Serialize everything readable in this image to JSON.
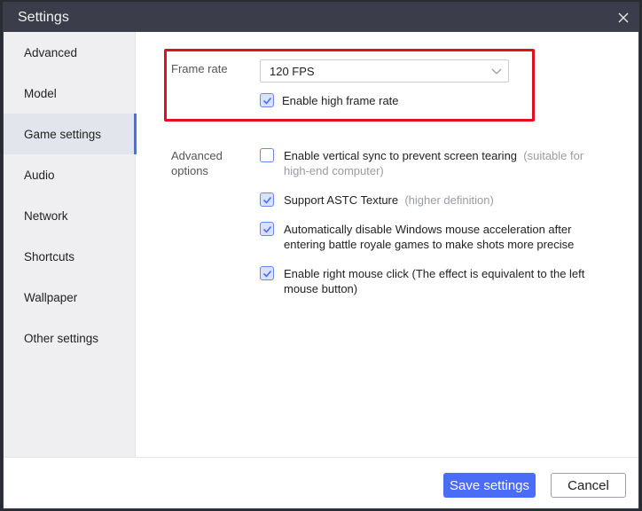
{
  "window": {
    "title": "Settings"
  },
  "sidebar": {
    "items": [
      {
        "label": "Advanced",
        "active": false
      },
      {
        "label": "Model",
        "active": false
      },
      {
        "label": "Game settings",
        "active": true
      },
      {
        "label": "Audio",
        "active": false
      },
      {
        "label": "Network",
        "active": false
      },
      {
        "label": "Shortcuts",
        "active": false
      },
      {
        "label": "Wallpaper",
        "active": false
      },
      {
        "label": "Other settings",
        "active": false
      }
    ]
  },
  "frame_rate": {
    "label": "Frame rate",
    "selected": "120 FPS",
    "high_frame_rate": {
      "label": "Enable high frame rate",
      "checked": true
    }
  },
  "advanced_options": {
    "label_line1": "Advanced",
    "label_line2": "options",
    "options": [
      {
        "line1": "Enable vertical sync to prevent screen tearing",
        "hint1": "(suitable for",
        "line2": "",
        "hint2": "high-end computer)",
        "checked": false
      },
      {
        "line1": "Support ASTC Texture",
        "hint1": "(higher definition)",
        "checked": true
      },
      {
        "line1": "Automatically disable Windows mouse acceleration after",
        "line2": "entering battle royale games to make shots more precise",
        "checked": true
      },
      {
        "line1": "Enable right mouse click (The effect is equivalent to the left",
        "line2": "mouse button)",
        "checked": true
      }
    ]
  },
  "footer": {
    "save_label": "Save settings",
    "cancel_label": "Cancel"
  },
  "colors": {
    "accent": "#4a6cf7",
    "highlight": "#e0101d",
    "titlebar": "#3b3e4a"
  }
}
